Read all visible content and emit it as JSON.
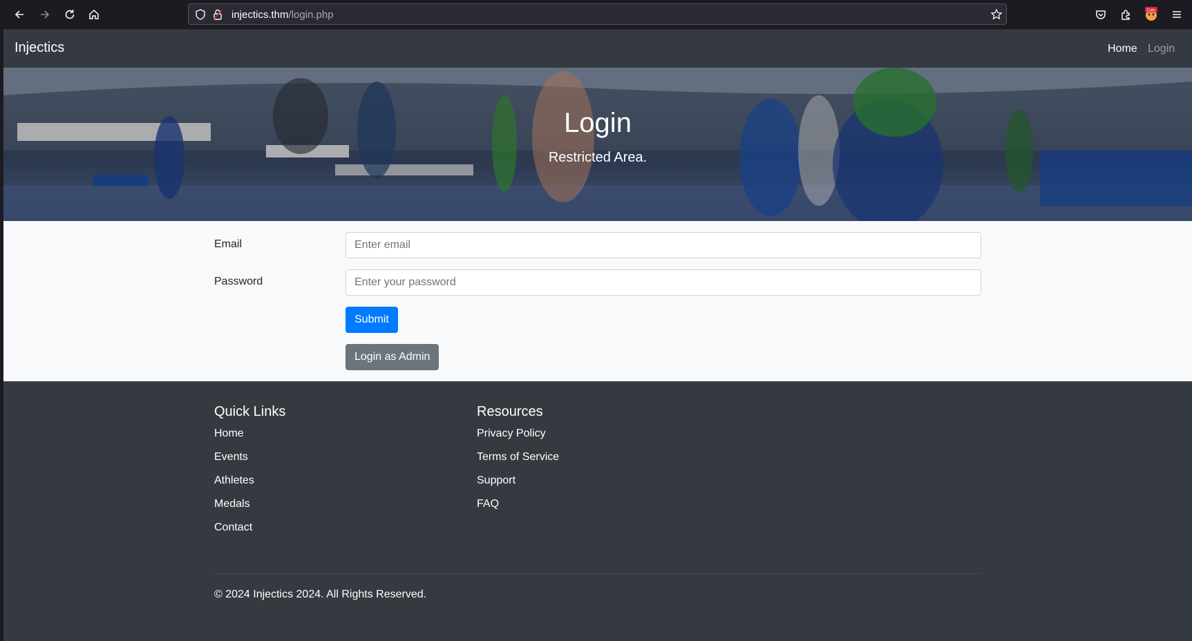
{
  "browser": {
    "url_host": "injectics.thm",
    "url_path": "/login.php",
    "extension_badge": "Calc"
  },
  "site": {
    "brand": "Injectics",
    "nav": {
      "home": "Home",
      "login": "Login"
    }
  },
  "hero": {
    "title": "Login",
    "subtitle": "Restricted Area."
  },
  "form": {
    "email_label": "Email",
    "email_placeholder": "Enter email",
    "password_label": "Password",
    "password_placeholder": "Enter your password",
    "submit_label": "Submit",
    "admin_label": "Login as Admin"
  },
  "footer": {
    "quick_links_title": "Quick Links",
    "quick_links": [
      "Home",
      "Events",
      "Athletes",
      "Medals",
      "Contact"
    ],
    "resources_title": "Resources",
    "resources": [
      "Privacy Policy",
      "Terms of Service",
      "Support",
      "FAQ"
    ],
    "copyright": "© 2024 Injectics 2024. All Rights Reserved."
  },
  "colors": {
    "navbar_bg": "#343a40",
    "primary": "#007bff",
    "secondary": "#6c757d",
    "form_bg": "#f8f9fa"
  }
}
